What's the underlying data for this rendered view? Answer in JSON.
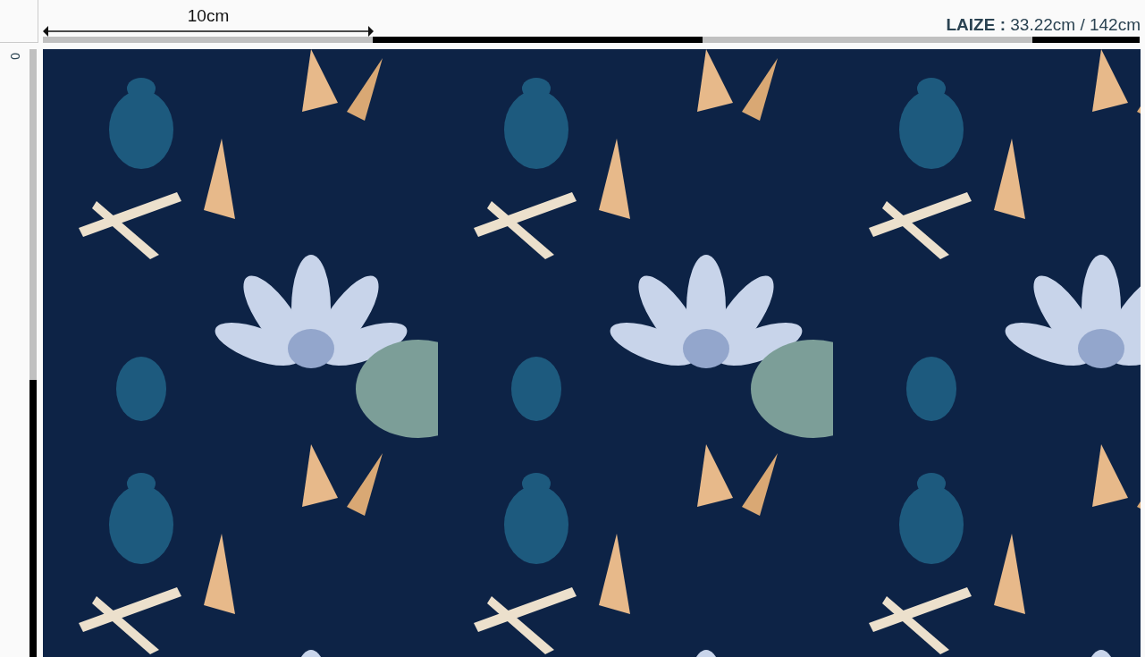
{
  "horizontal_ruler": {
    "label": "10cm"
  },
  "width_info": {
    "label": "LAIZE :",
    "value": "33.22cm / 142cm"
  },
  "vertical_ruler": {
    "label": "0"
  }
}
